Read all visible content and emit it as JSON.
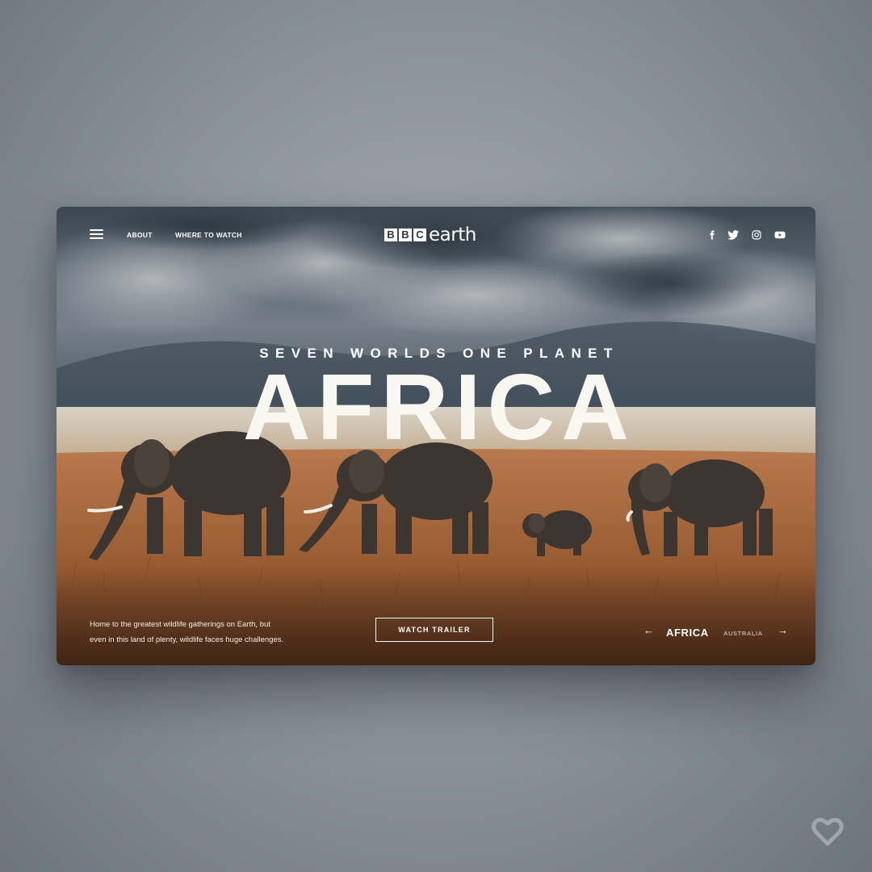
{
  "nav": {
    "links": [
      "ABOUT",
      "WHERE TO WATCH"
    ],
    "logo_boxes": [
      "B",
      "B",
      "C"
    ],
    "logo_word": "earth",
    "social_icons": [
      "facebook-icon",
      "twitter-icon",
      "instagram-icon",
      "youtube-icon"
    ]
  },
  "hero": {
    "subtitle": "SEVEN WORLDS ONE PLANET",
    "headline": "AFRICA"
  },
  "footer": {
    "description_line1": "Home to the greatest wildlife gatherings on Earth, but",
    "description_line2": "even in this land of plenty, wildlife faces huge challenges.",
    "cta_label": "WATCH TRAILER",
    "prev_arrow": "←",
    "next_arrow": "→",
    "current_region": "AFRICA",
    "next_region": "AUSTRALIA"
  },
  "colors": {
    "accent": "#ffffff",
    "headline": "#f8f7f0",
    "page_background": "#8f969e"
  }
}
